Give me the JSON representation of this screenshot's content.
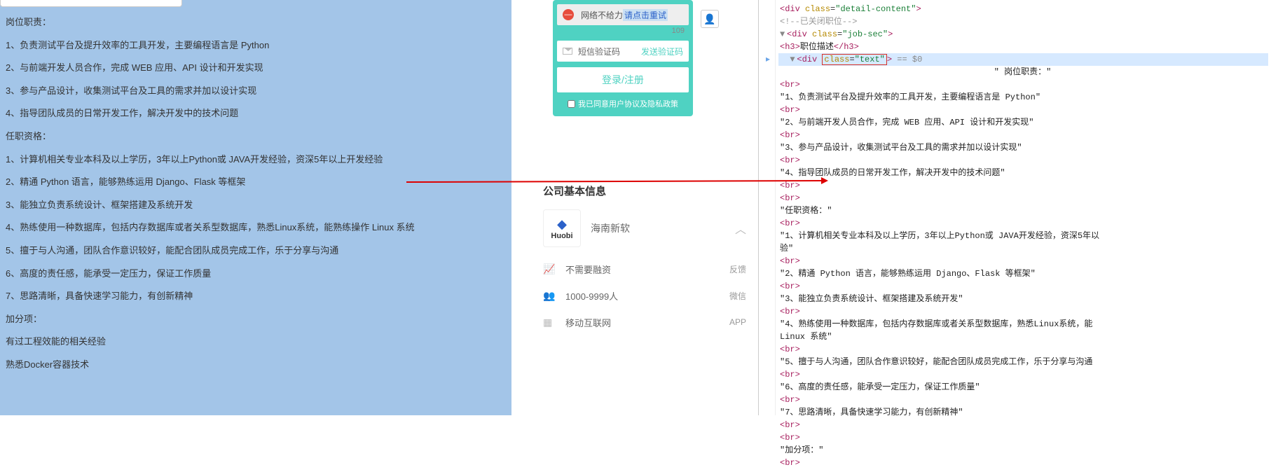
{
  "left": {
    "title": "岗位职责：",
    "duties": [
      "1、负责测试平台及提升效率的工具开发，主要编程语言是 Python",
      "2、与前端开发人员合作，完成 WEB 应用、API 设计和开发实现",
      "3、参与产品设计，收集测试平台及工具的需求并加以设计实现",
      "4、指导团队成员的日常开发工作，解决开发中的技术问题"
    ],
    "qual_title": "任职资格：",
    "quals": [
      "1、计算机相关专业本科及以上学历，3年以上Python或 JAVA开发经验，资深5年以上开发经验",
      "2、精通 Python 语言，能够熟练运用 Django、Flask 等框架",
      "3、能独立负责系统设计、框架搭建及系统开发",
      "4、熟练使用一种数据库，包括内存数据库或者关系型数据库，熟悉Linux系统，能熟练操作 Linux 系统",
      "5、擅于与人沟通，团队合作意识较好，能配合团队成员完成工作，乐于分享与沟通",
      "6、高度的责任感，能承受一定压力，保证工作质量",
      "7、思路清晰，具备快速学习能力，有创新精神"
    ],
    "extra_title": "加分项：",
    "extras": [
      "有过工程效能的相关经验",
      "熟悉Docker容器技术"
    ]
  },
  "form": {
    "err_text": "网络不给力 ",
    "err_link": "请点击重试",
    "count": "109",
    "sms_placeholder": "短信验证码",
    "send_code": "发送验证码",
    "login_btn": "登录/注册",
    "agree": "我已同意用户协议及隐私政策"
  },
  "company": {
    "heading": "公司基本信息",
    "logo_text": "Huobi",
    "name": "海南新软",
    "rows": [
      {
        "icon": "chart",
        "label": "不需要融资",
        "side": "反馈"
      },
      {
        "icon": "people",
        "label": "1000-9999人",
        "side": "微信"
      },
      {
        "icon": "grid",
        "label": "移动互联网",
        "side": "APP"
      }
    ]
  },
  "devtools": {
    "top_div": "detail-content",
    "comment": "<!--已关闭职位-->",
    "job_sec": "job-sec",
    "h3": "职位描述",
    "text_class": "text",
    "eq0": " == $0",
    "lines": [
      "岗位职责：\"",
      "\"1、负责测试平台及提升效率的工具开发，主要编程语言是 Python\"",
      "\"2、与前端开发人员合作，完成 WEB 应用、API 设计和开发实现\"",
      "\"3、参与产品设计，收集测试平台及工具的需求并加以设计实现\"",
      "\"4、指导团队成员的日常开发工作，解决开发中的技术问题\"",
      "\"任职资格：\"",
      "\"1、计算机相关专业本科及以上学历，3年以上Python或 JAVA开发经验，资深5年以",
      "验\"",
      "\"2、精通 Python 语言，能够熟练运用 Django、Flask 等框架\"",
      "\"3、能独立负责系统设计、框架搭建及系统开发\"",
      "\"4、熟练使用一种数据库，包括内存数据库或者关系型数据库，熟悉Linux系统，能",
      "Linux 系统\"",
      "\"5、擅于与人沟通，团队合作意识较好，能配合团队成员完成工作，乐于分享与沟通",
      "\"6、高度的责任感，能承受一定压力，保证工作质量\"",
      "\"7、思路清晰，具备快速学习能力，有创新精神\"",
      "\"加分项：\""
    ]
  }
}
